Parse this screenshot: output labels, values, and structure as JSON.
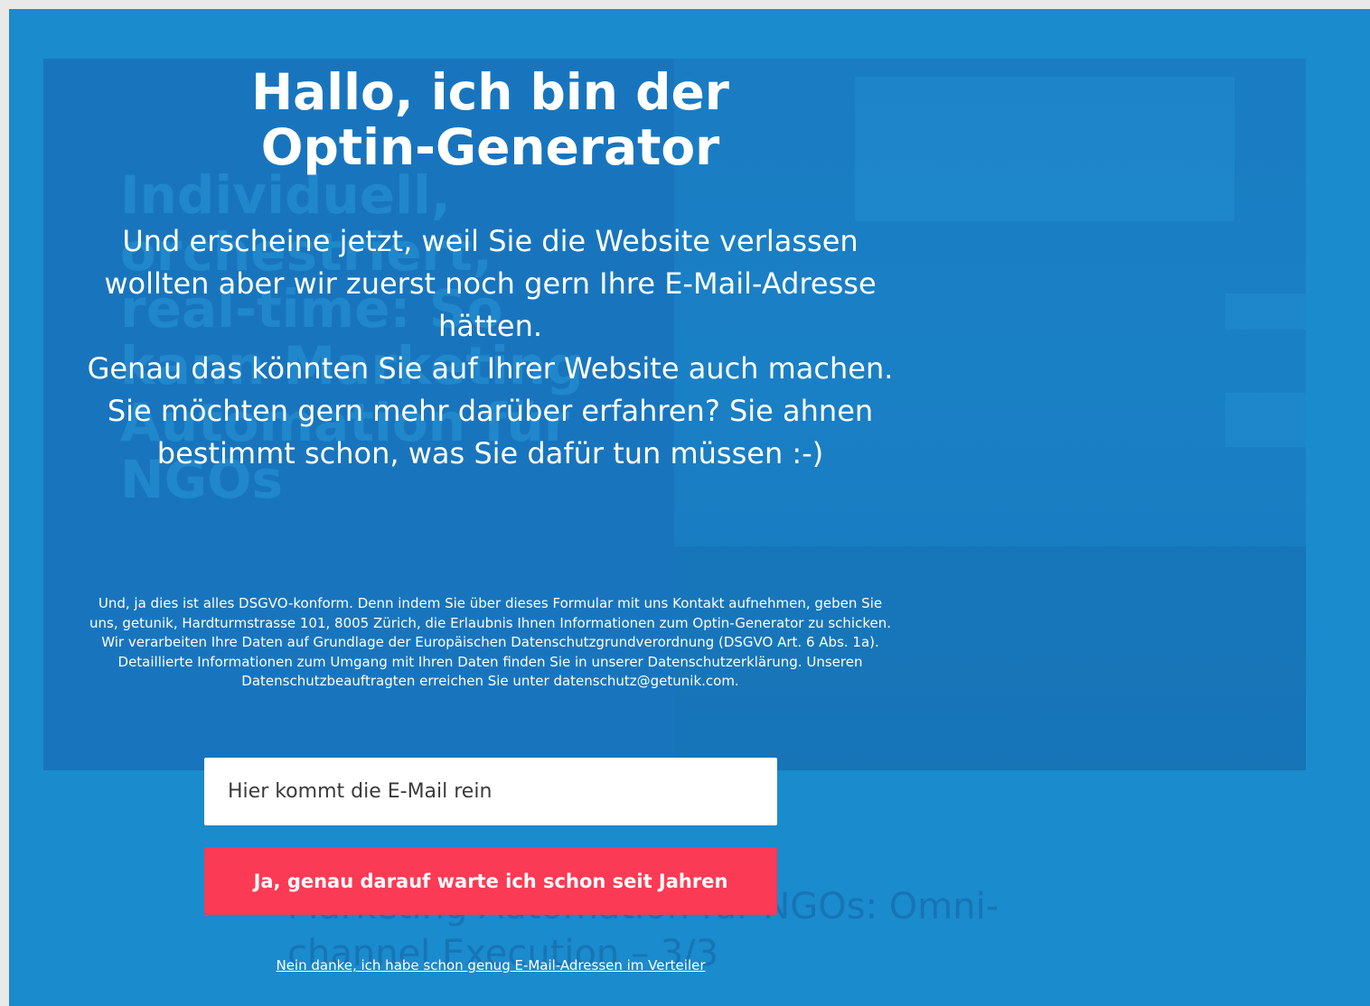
{
  "colors": {
    "overlay_background": "#1a8bcd",
    "cta_background": "#fb3a55",
    "text": "#ffffff",
    "input_background": "#ffffff"
  },
  "popup": {
    "title": "Hallo, ich bin der Optin-Generator",
    "body": "Und erscheine jetzt, weil Sie die Website verlassen wollten aber wir zuerst noch gern Ihre E-Mail-Adresse hätten.\nGenau das könnten Sie auf Ihrer Website auch machen. Sie möchten gern mehr darüber erfahren? Sie ahnen bestimmt schon, was Sie dafür tun müssen :-)",
    "legal": "Und, ja dies ist alles DSGVO-konform. Denn indem Sie über dieses Formular mit uns Kontakt aufnehmen, geben Sie uns, getunik, Hardturmstrasse 101, 8005 Zürich, die Erlaubnis Ihnen Informationen zum Optin-Generator zu schicken. Wir verarbeiten Ihre Daten auf Grundlage der Europäischen Datenschutzgrundverordnung (DSGVO Art. 6 Abs. 1a). Detaillierte Informationen zum Umgang mit Ihren Daten finden Sie in unserer Datenschutzerklärung. Unseren Datenschutzbeauftragten erreichen Sie unter datenschutz@getunik.com.",
    "email_placeholder": "Hier kommt die E-Mail rein",
    "email_value": "",
    "cta_label": "Ja, genau darauf warte ich schon seit Jahren",
    "decline_label": "Nein danke, ich habe schon genug E-Mail-Adressen im Verteiler"
  },
  "background_page": {
    "hero_headline": "Individuell, orchestriert, real-time: So kann Marketing Automation für NGOs",
    "article_title": "Marketing Automation für NGOs: Omni-channel Execution – 3/3"
  }
}
